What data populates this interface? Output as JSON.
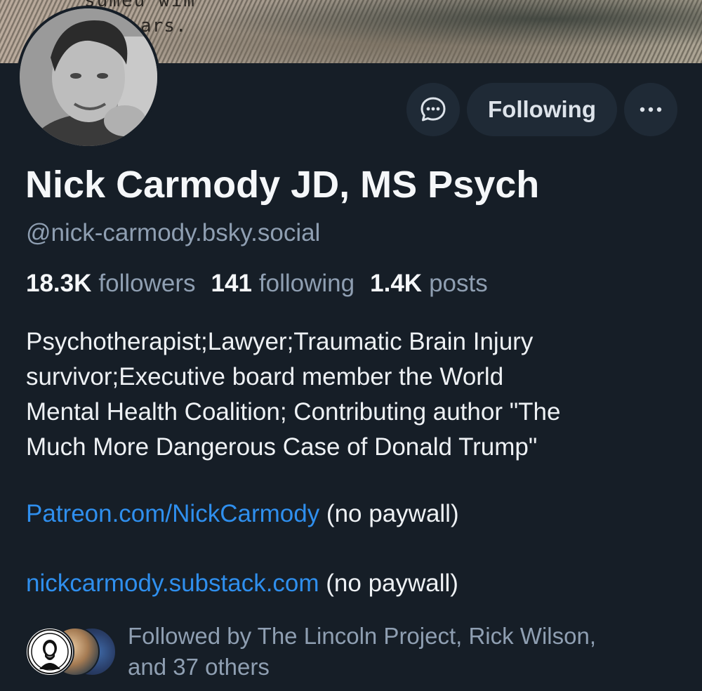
{
  "banner": {
    "text_top": "sumeu wim",
    "text_visible": "ars."
  },
  "profile": {
    "display_name": "Nick Carmody JD, MS Psych",
    "handle": "@nick-carmody.bsky.social"
  },
  "actions": {
    "following_label": "Following",
    "message_icon": "chat-bubble-icon",
    "more_icon": "ellipsis-icon"
  },
  "stats": {
    "followers_count": "18.3K",
    "followers_label": "followers",
    "following_count": "141",
    "following_label": "following",
    "posts_count": "1.4K",
    "posts_label": "posts"
  },
  "bio": {
    "lines": [
      "Psychotherapist;Lawyer;Traumatic Brain Injury",
      "survivor;Executive board member the World",
      "Mental Health Coalition; Contributing author \"The",
      "Much More Dangerous Case of Donald Trump\""
    ],
    "patreon_link": "Patreon.com/NickCarmody",
    "patreon_suffix": " (no paywall)",
    "substack_link": "nickcarmody.substack.com",
    "substack_suffix": " (no paywall)"
  },
  "followed_by": {
    "line1": "Followed by The Lincoln Project, Rick Wilson,",
    "line2": "and 37 others"
  },
  "colors": {
    "background": "#161e27",
    "button_bg": "#1f2a36",
    "muted_text": "#8f9fb2",
    "link": "#2f8fee"
  }
}
